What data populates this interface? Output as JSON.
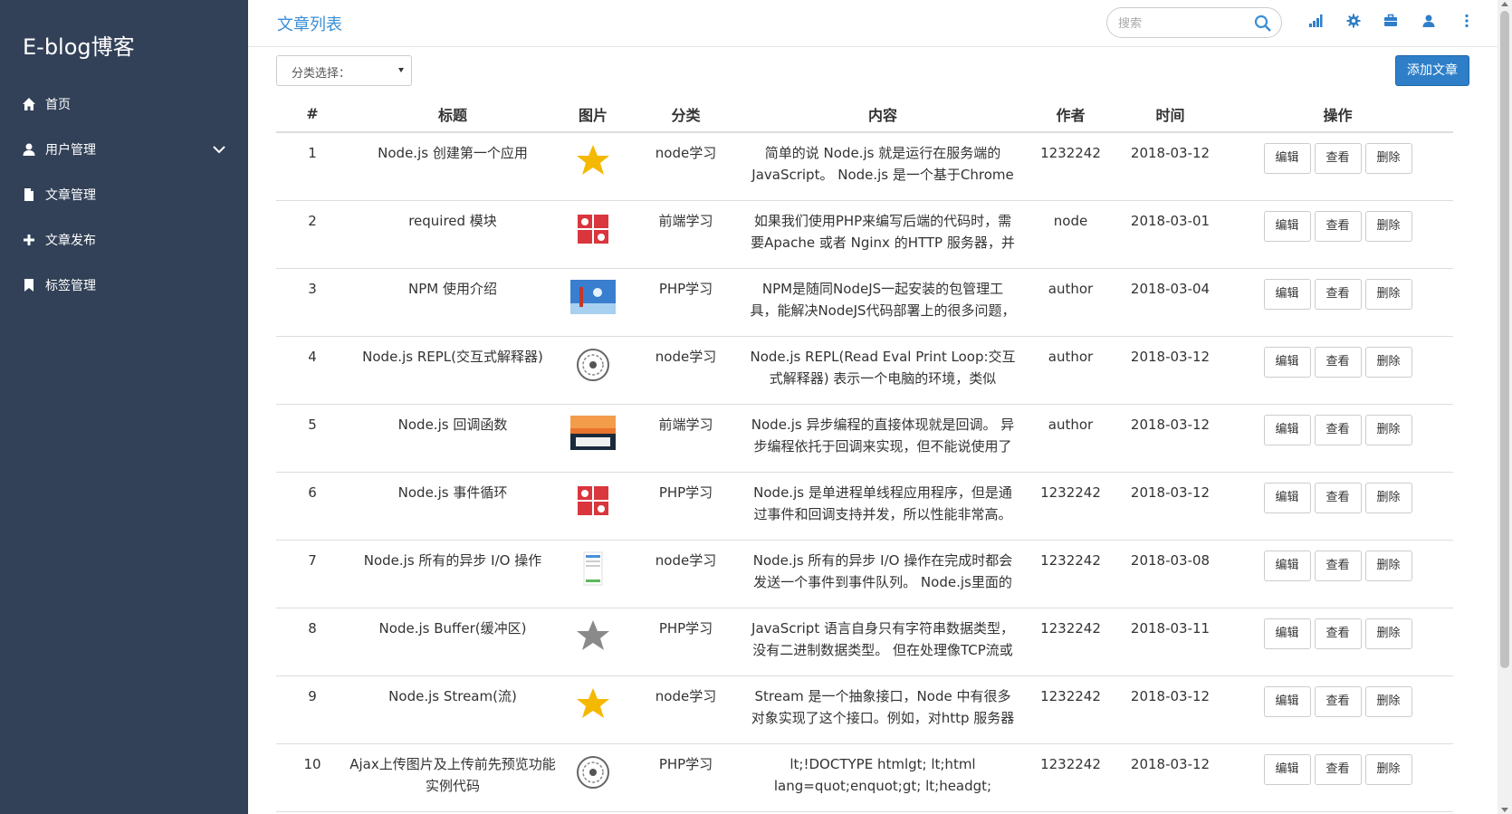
{
  "sidebar": {
    "brand": "E-blog博客",
    "items": [
      {
        "label": "首页",
        "icon": "home-icon"
      },
      {
        "label": "用户管理",
        "icon": "user-icon",
        "expandable": true
      },
      {
        "label": "文章管理",
        "icon": "file-icon"
      },
      {
        "label": "文章发布",
        "icon": "plus-icon"
      },
      {
        "label": "标签管理",
        "icon": "bookmark-icon"
      }
    ]
  },
  "header": {
    "title": "文章列表",
    "search_placeholder": "搜索"
  },
  "toolbar": {
    "category_select": "分类选择：",
    "add_label": "添加文章"
  },
  "table": {
    "columns": [
      "#",
      "标题",
      "图片",
      "分类",
      "内容",
      "作者",
      "时间",
      "操作"
    ],
    "rows": [
      {
        "id": "1",
        "title": "Node.js 创建第一个应用",
        "image": "gold-star",
        "category": "node学习",
        "content": "简单的说 Node.js 就是运行在服务端的 JavaScript。 Node.js 是一个基于Chrome",
        "author": "1232242",
        "date": "2018-03-12"
      },
      {
        "id": "2",
        "title": "required 模块",
        "image": "red-cards",
        "category": "前端学习",
        "content": "如果我们使用PHP来编写后端的代码时，需要Apache 或者 Nginx 的HTTP 服务器，并",
        "author": "node",
        "date": "2018-03-01"
      },
      {
        "id": "3",
        "title": "NPM 使用介绍",
        "image": "blue-photo",
        "category": "PHP学习",
        "content": "NPM是随同NodeJS一起安装的包管理工具，能解决NodeJS代码部署上的很多问题，",
        "author": "author",
        "date": "2018-03-04"
      },
      {
        "id": "4",
        "title": "Node.js REPL(交互式解释器)",
        "image": "stamp-seal",
        "category": "node学习",
        "content": "Node.js REPL(Read Eval Print Loop:交互式解释器) 表示一个电脑的环境，类似 Window",
        "author": "author",
        "date": "2018-03-12"
      },
      {
        "id": "5",
        "title": "Node.js 回调函数",
        "image": "orange-photo",
        "category": "前端学习",
        "content": "Node.js 异步编程的直接体现就是回调。 异步编程依托于回调来实现，但不能说使用了",
        "author": "author",
        "date": "2018-03-12"
      },
      {
        "id": "6",
        "title": "Node.js 事件循环",
        "image": "red-cards",
        "category": "PHP学习",
        "content": "Node.js 是单进程单线程应用程序，但是通过事件和回调支持并发，所以性能非常高。",
        "author": "1232242",
        "date": "2018-03-12"
      },
      {
        "id": "7",
        "title": "Node.js 所有的异步 I/O 操作",
        "image": "phone-screen",
        "category": "node学习",
        "content": "Node.js 所有的异步 I/O 操作在完成时都会发送一个事件到事件队列。 Node.js里面的许",
        "author": "1232242",
        "date": "2018-03-08"
      },
      {
        "id": "8",
        "title": "Node.js Buffer(缓冲区)",
        "image": "gray-star",
        "category": "PHP学习",
        "content": "JavaScript 语言自身只有字符串数据类型，没有二进制数据类型。 但在处理像TCP流或",
        "author": "1232242",
        "date": "2018-03-11"
      },
      {
        "id": "9",
        "title": "Node.js Stream(流)",
        "image": "gold-star",
        "category": "node学习",
        "content": "Stream 是一个抽象接口，Node 中有很多对象实现了这个接口。例如，对http 服务器发",
        "author": "1232242",
        "date": "2018-03-12"
      },
      {
        "id": "10",
        "title": "Ajax上传图片及上传前先预览功能实例代码",
        "image": "stamp-seal",
        "category": "PHP学习",
        "content": "lt;!DOCTYPE htmlgt; lt;html lang=quot;enquot;gt; lt;headgt; nbsp;lt;meta",
        "author": "1232242",
        "date": "2018-03-12"
      }
    ],
    "actions": {
      "edit": "编辑",
      "view": "查看",
      "delete": "删除"
    }
  },
  "colors": {
    "sidebar_bg": "#324158",
    "accent": "#2f7fc8",
    "title_color": "#3a8fd6",
    "star_gold": "#f5b800",
    "star_gray": "#8a8a8a"
  }
}
